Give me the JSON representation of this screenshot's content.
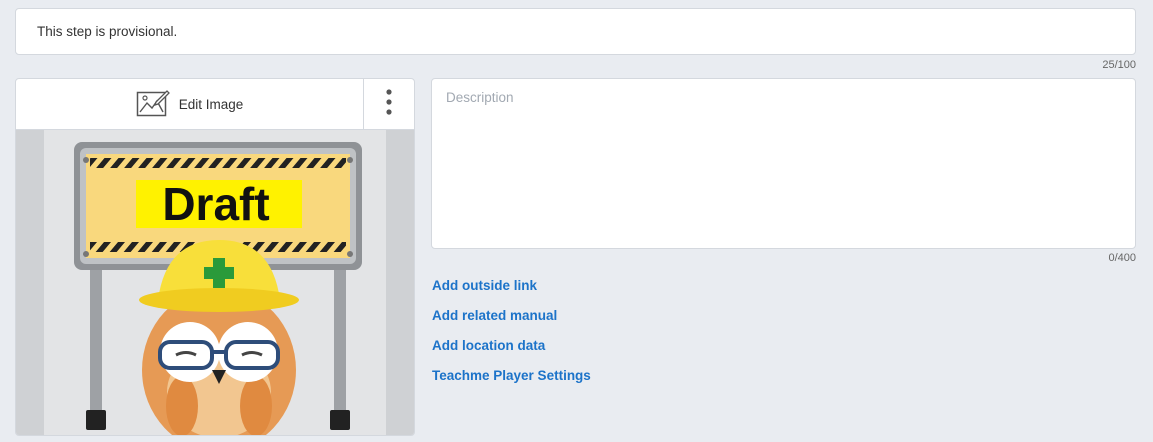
{
  "step": {
    "title_value": "This step is provisional.",
    "title_counter": "25/100"
  },
  "image_card": {
    "edit_label": "Edit Image",
    "image_text": "Draft"
  },
  "description": {
    "placeholder": "Description",
    "counter": "0/400"
  },
  "links": {
    "outside_link": "Add outside link",
    "related_manual": "Add related manual",
    "location_data": "Add location data",
    "player_settings": "Teachme Player Settings"
  },
  "colors": {
    "link": "#1c73c9",
    "background": "#e9ecf1",
    "sign_yellow": "#f9d87d",
    "draft_highlight": "#fff200"
  }
}
